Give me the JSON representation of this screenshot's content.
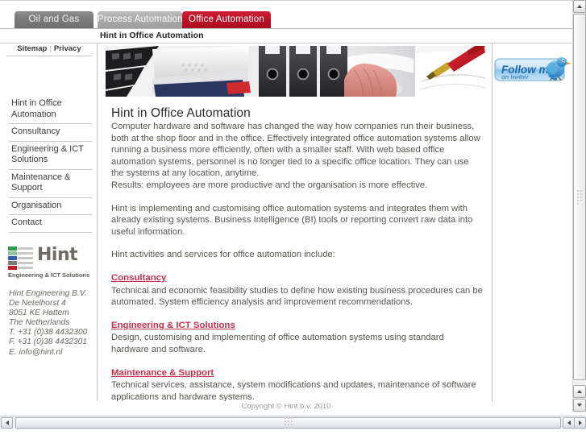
{
  "tabs": [
    {
      "label": "Oil and Gas",
      "active": false
    },
    {
      "label": "Process Automation",
      "active": false
    },
    {
      "label": "Office Automation",
      "active": true
    }
  ],
  "page_title": "Hint in Office Automation",
  "sidebar": {
    "utility": {
      "sitemap": "Sitemap",
      "separator": "|",
      "privacy": "Privacy"
    },
    "nav_items": [
      {
        "label": "Hint in Office Automation"
      },
      {
        "label": "Consultancy"
      },
      {
        "label": "Engineering & ICT Solutions"
      },
      {
        "label": "Maintenance & Support"
      },
      {
        "label": "Organisation"
      },
      {
        "label": "Contact"
      }
    ],
    "logo": {
      "wordmark": "Hint",
      "tagline": "Engineering & ICT Solutions",
      "bar_colors": [
        "#2e9c4d",
        "#2f5fae",
        "#7a7a7a",
        "#c01c2c"
      ]
    },
    "contact": {
      "company": "Hint Engineering B.V.",
      "street": "De Netelhorst 4",
      "postal": "8051 KE Hattem",
      "country": "The Netherlands",
      "phone": "T. +31 (0)38 4432300",
      "fax": "F. +31 (0)38 4432301",
      "email": "E. info@hint.nl"
    }
  },
  "main": {
    "heading": "Hint in Office Automation",
    "paragraph_1": "Computer hardware and software has changed the way how companies run their business, both at the shop floor and in the office. Effectively integrated office automation systems allow running a business more efficiently, often with a smaller staff. With web based office automation systems, personnel is no longer tied to a specific office location. They can use the systems at any location, anytime.",
    "paragraph_1_results": "Results: employees are more productive and the organisation is more effective.",
    "paragraph_2": "Hint is implementing and customising office automation systems and integrates them with already existing systems. Business Intelligence (BI) tools or reporting convert raw data into useful information.",
    "paragraph_3": "Hint activities and services for office automation include:",
    "services": [
      {
        "link": "Consultancy",
        "description": "Technical and economic feasibility studies to define how existing business procedures can be automated. System efficiency analysis and improvement recommendations."
      },
      {
        "link": "Engineering & ICT Solutions",
        "description": "Design, customising and implementing of office automation systems using standard hardware and software."
      },
      {
        "link": "Maintenance & Support",
        "description": "Technical services, assistance, system modifications and updates, maintenance of software applications and hardware systems."
      }
    ]
  },
  "right": {
    "twitter_badge": {
      "line1": "Follow me",
      "line2": "on twitter"
    }
  },
  "footer": {
    "copyright": "Copyright © Hint b.v. 2010"
  },
  "colors": {
    "active_tab": "#bd0f26",
    "link": "#c4314b",
    "body_text": "#57554f",
    "heading": "#2c2c2c",
    "border": "#bfbfbf"
  }
}
